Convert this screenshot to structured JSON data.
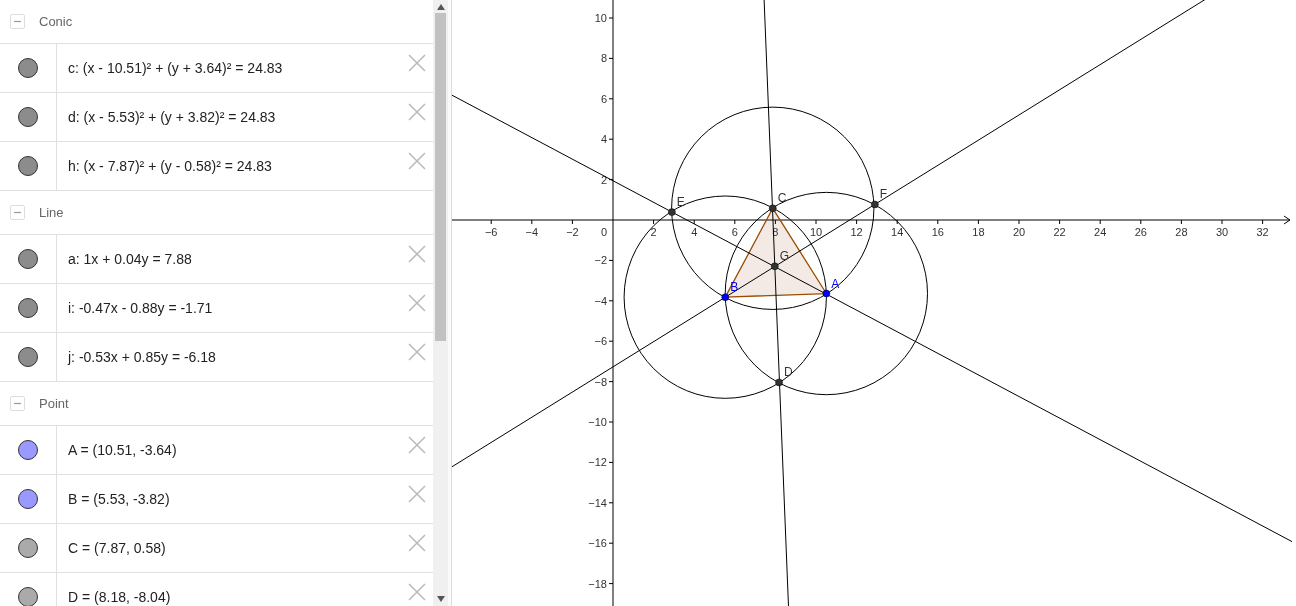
{
  "algebra": {
    "groups": [
      {
        "title": "Conic",
        "expanded": true,
        "items": [
          {
            "text": "c: (x - 10.51)² + (y + 3.64)² = 24.83",
            "color": "#8c8c8c"
          },
          {
            "text": "d: (x - 5.53)² + (y + 3.82)² = 24.83",
            "color": "#8c8c8c"
          },
          {
            "text": "h: (x - 7.87)² + (y - 0.58)² = 24.83",
            "color": "#8c8c8c"
          }
        ]
      },
      {
        "title": "Line",
        "expanded": true,
        "items": [
          {
            "text": "a: 1x + 0.04y = 7.88",
            "color": "#8c8c8c"
          },
          {
            "text": "i: -0.47x - 0.88y = -1.71",
            "color": "#8c8c8c"
          },
          {
            "text": "j: -0.53x + 0.85y = -6.18",
            "color": "#8c8c8c"
          }
        ]
      },
      {
        "title": "Point",
        "expanded": true,
        "items": [
          {
            "text": "A = (10.51, -3.64)",
            "color": "#9999ff"
          },
          {
            "text": "B = (5.53, -3.82)",
            "color": "#9999ff"
          },
          {
            "text": "C = (7.87, 0.58)",
            "color": "#aaaaaa"
          },
          {
            "text": "D = (8.18, -8.04)",
            "color": "#aaaaaa"
          }
        ]
      }
    ]
  },
  "graphics": {
    "xticks": [
      "−6",
      "−4",
      "−2",
      "2",
      "4",
      "6",
      "8",
      "10",
      "12",
      "14",
      "16",
      "18",
      "20",
      "22",
      "24",
      "26",
      "28",
      "30",
      "32"
    ],
    "yticks": [
      "10",
      "8",
      "6",
      "4",
      "2",
      "−2",
      "−4",
      "−6",
      "−8",
      "−10",
      "−12",
      "−14",
      "−16",
      "−18"
    ],
    "origin_label": "0",
    "points": [
      {
        "label": "A",
        "color": "#0000ff"
      },
      {
        "label": "B",
        "color": "#0000ff"
      },
      {
        "label": "C",
        "color": "#333333"
      },
      {
        "label": "D",
        "color": "#333333"
      },
      {
        "label": "E",
        "color": "#333333"
      },
      {
        "label": "F",
        "color": "#333333"
      },
      {
        "label": "G",
        "color": "#333333"
      }
    ]
  }
}
